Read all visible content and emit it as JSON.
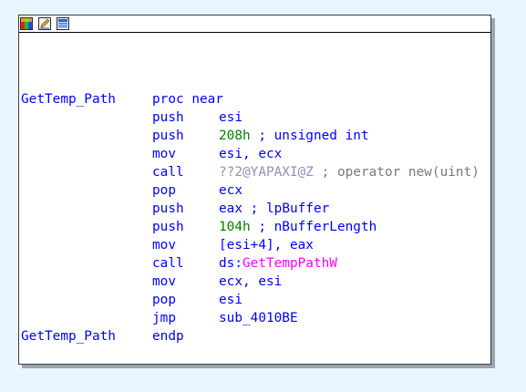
{
  "colors": {
    "background": "#eaf6ff",
    "keyword_blue": "#0000ff",
    "number_green": "#008000",
    "import_magenta": "#ff00ff",
    "comment_grey": "#7a7a7a",
    "mangled_name": "#9090b8"
  },
  "header": {
    "buttons": [
      {
        "icon": "color-palette-icon"
      },
      {
        "icon": "rename-pencil-icon"
      },
      {
        "icon": "graph-overview-icon"
      }
    ]
  },
  "proc": {
    "name": "GetTemp_Path",
    "start_mnemonic": "proc near",
    "end_label": "GetTemp_Path",
    "end_mnemonic": "endp"
  },
  "instructions": [
    {
      "mnemonic": "push",
      "operand": "esi"
    },
    {
      "mnemonic": "push",
      "operand_num": "208h",
      "comment": " ; unsigned int"
    },
    {
      "mnemonic": "mov",
      "operand": "esi, ecx"
    },
    {
      "mnemonic": "call",
      "operand_sym": "??2@YAPAXI@Z",
      "comment": " ; operator new(uint)"
    },
    {
      "mnemonic": "pop",
      "operand": "ecx"
    },
    {
      "mnemonic": "push",
      "operand": "eax",
      "comment": " ; lpBuffer"
    },
    {
      "mnemonic": "push",
      "operand_num": "104h",
      "comment": " ; nBufferLength"
    },
    {
      "mnemonic": "mov",
      "operand": "[esi+4], eax"
    },
    {
      "mnemonic": "call",
      "operand_prefix": "ds:",
      "operand_import": "GetTempPathW"
    },
    {
      "mnemonic": "mov",
      "operand": "ecx, esi"
    },
    {
      "mnemonic": "pop",
      "operand": "esi"
    },
    {
      "mnemonic": "jmp",
      "operand": "sub_4010BE"
    }
  ]
}
